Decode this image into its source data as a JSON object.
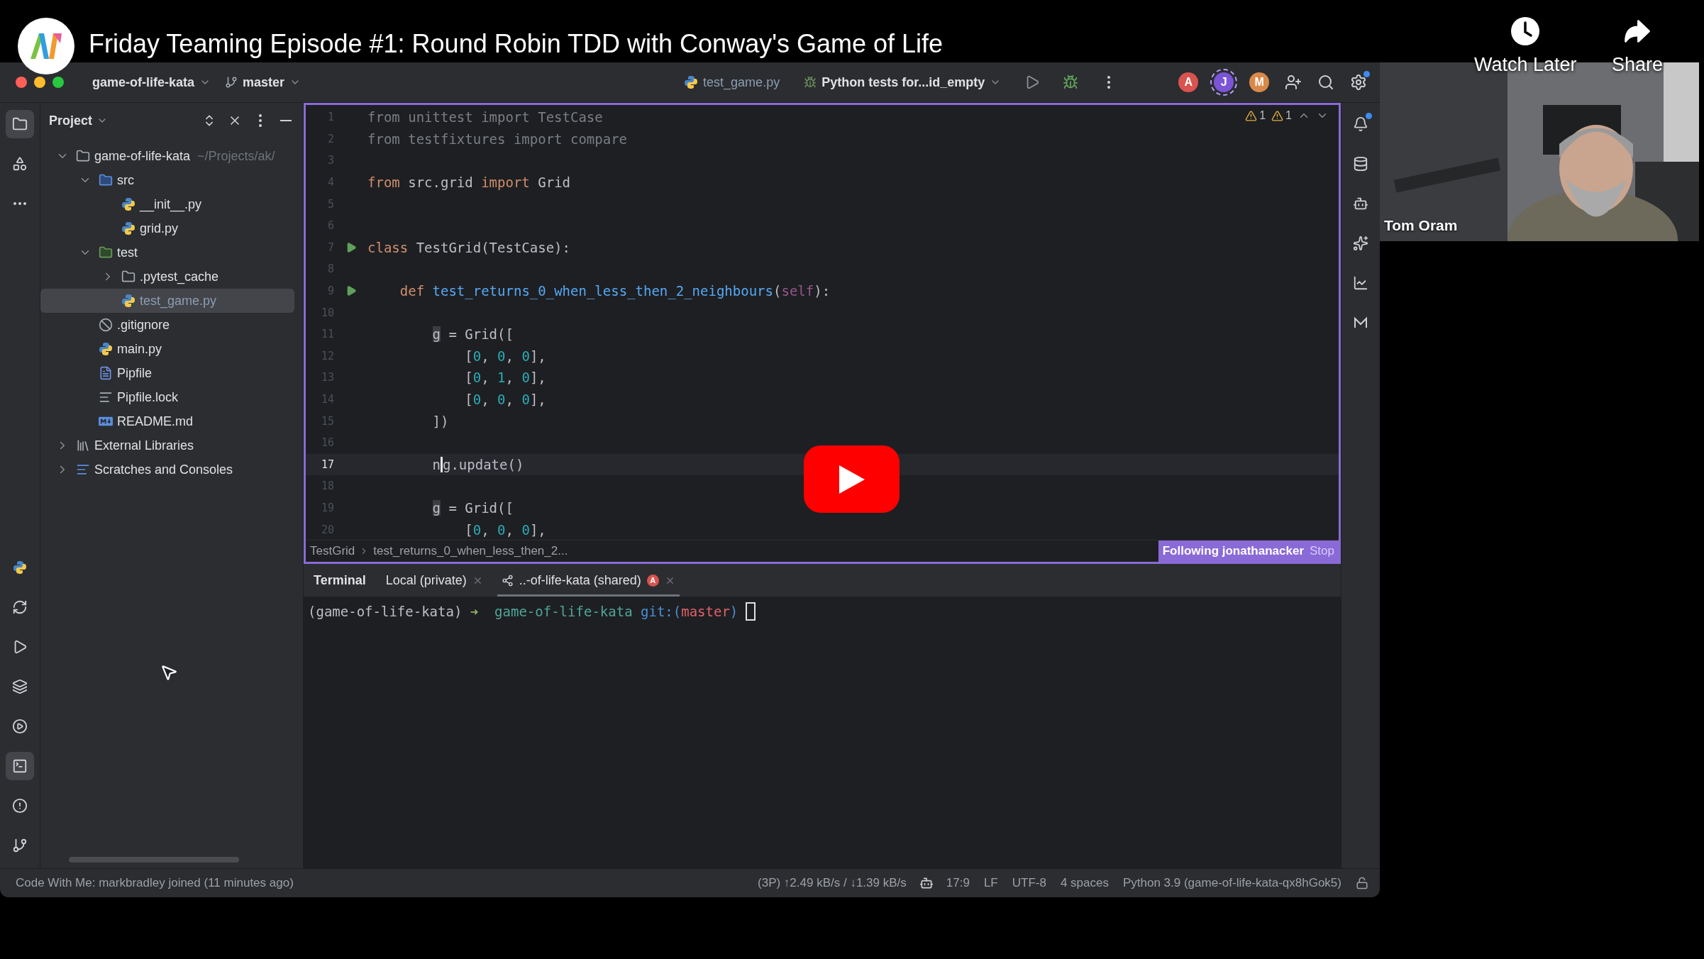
{
  "video": {
    "title": "Friday Teaming Episode #1: Round Robin TDD with Conway's Game of Life",
    "actions": [
      {
        "kind": "clock",
        "label": "Watch Later"
      },
      {
        "kind": "share",
        "label": "Share"
      }
    ],
    "webcam": {
      "kind": "picture",
      "name": "Tom Oram"
    }
  },
  "ide": {
    "toolbar": {
      "project": "game-of-life-kata",
      "branch": "master",
      "file": "test_game.py",
      "run_config": "Python tests for...id_empty",
      "collaborators": [
        {
          "initial": "A",
          "color": "#d9534f",
          "selected": false
        },
        {
          "initial": "J",
          "color": "#7b55d6",
          "selected": true
        },
        {
          "initial": "M",
          "color": "#d98a4a",
          "selected": false
        }
      ],
      "settings_dot": true
    },
    "left_stripe": {
      "top": [
        {
          "kind": "folder",
          "selected": true
        },
        {
          "kind": "structure",
          "selected": false
        },
        {
          "kind": "more",
          "selected": false
        }
      ],
      "bottom": [
        {
          "kind": "python",
          "selected": false
        },
        {
          "kind": "python-console",
          "selected": false
        },
        {
          "kind": "run",
          "selected": false
        },
        {
          "kind": "layers",
          "selected": false
        },
        {
          "kind": "services",
          "selected": false
        },
        {
          "kind": "terminal",
          "selected": true
        },
        {
          "kind": "problems",
          "selected": false
        },
        {
          "kind": "git",
          "selected": false
        }
      ]
    },
    "project": {
      "title": "Project",
      "tree": [
        {
          "label": "game-of-life-kata",
          "hint": "~/Projects/ak/",
          "kind": "folder",
          "expanded": true,
          "selected": false,
          "children": [
            {
              "label": "src",
              "kind": "source-folder",
              "expanded": true,
              "selected": false,
              "children": [
                {
                  "label": "__init__.py",
                  "kind": "python",
                  "selected": false
                },
                {
                  "label": "grid.py",
                  "kind": "python",
                  "selected": false
                }
              ]
            },
            {
              "label": "test",
              "kind": "test-folder",
              "expanded": true,
              "selected": false,
              "children": [
                {
                  "label": ".pytest_cache",
                  "kind": "folder",
                  "expanded": false,
                  "selected": false
                },
                {
                  "label": "test_game.py",
                  "kind": "python",
                  "selected": true
                }
              ]
            },
            {
              "label": ".gitignore",
              "kind": "ignore",
              "selected": false
            },
            {
              "label": "main.py",
              "kind": "python",
              "selected": false
            },
            {
              "label": "Pipfile",
              "kind": "pipfile",
              "selected": false
            },
            {
              "label": "Pipfile.lock",
              "kind": "lines",
              "selected": false
            },
            {
              "label": "README.md",
              "kind": "markdown",
              "selected": false
            }
          ]
        },
        {
          "label": "External Libraries",
          "kind": "libraries",
          "expanded": false,
          "selected": false
        },
        {
          "label": "Scratches and Consoles",
          "kind": "scratches",
          "expanded": false,
          "selected": false
        }
      ]
    },
    "editor": {
      "warnings": [
        {
          "count": "1"
        },
        {
          "count": "1"
        }
      ],
      "lines": [
        {
          "number": "1",
          "run": false,
          "current": false,
          "tokens": [
            {
              "text": "from unittest import TestCase",
              "kind": "unused"
            }
          ]
        },
        {
          "number": "2",
          "run": false,
          "current": false,
          "tokens": [
            {
              "text": "from testfixtures import compare",
              "kind": "unused"
            }
          ]
        },
        {
          "number": "3",
          "run": false,
          "current": false
        },
        {
          "number": "4",
          "run": false,
          "current": false,
          "tokens": [
            {
              "text": "from",
              "kind": "keyword"
            },
            {
              "text": " src.grid ",
              "kind": "plain"
            },
            {
              "text": "import",
              "kind": "keyword"
            },
            {
              "text": " Grid",
              "kind": "plain"
            }
          ]
        },
        {
          "number": "5",
          "run": false,
          "current": false
        },
        {
          "number": "6",
          "run": false,
          "current": false
        },
        {
          "number": "7",
          "run": true,
          "current": false,
          "tokens": [
            {
              "text": "class",
              "kind": "keyword"
            },
            {
              "text": " TestGrid(TestCase):",
              "kind": "plain"
            }
          ]
        },
        {
          "number": "8",
          "run": false,
          "current": false
        },
        {
          "number": "9",
          "run": true,
          "current": false,
          "tokens": [
            {
              "text": "    def",
              "kind": "keyword"
            },
            {
              "text": " test_returns_0_when_less_then_2_neighbours",
              "kind": "function"
            },
            {
              "text": "(",
              "kind": "plain"
            },
            {
              "text": "self",
              "kind": "self"
            },
            {
              "text": "):",
              "kind": "plain"
            }
          ]
        },
        {
          "number": "10",
          "run": false,
          "current": false
        },
        {
          "number": "11",
          "run": false,
          "current": false,
          "tokens": [
            {
              "text": "        g",
              "kind": "highlight"
            },
            {
              "text": " = Grid([",
              "kind": "plain"
            }
          ]
        },
        {
          "number": "12",
          "run": false,
          "current": false,
          "tokens": [
            {
              "text": "            [",
              "kind": "plain"
            },
            {
              "text": "0",
              "kind": "number"
            },
            {
              "text": ", ",
              "kind": "plain"
            },
            {
              "text": "0",
              "kind": "number"
            },
            {
              "text": ", ",
              "kind": "plain"
            },
            {
              "text": "0",
              "kind": "number"
            },
            {
              "text": "],",
              "kind": "plain"
            }
          ]
        },
        {
          "number": "13",
          "run": false,
          "current": false,
          "tokens": [
            {
              "text": "            [",
              "kind": "plain"
            },
            {
              "text": "0",
              "kind": "number"
            },
            {
              "text": ", ",
              "kind": "plain"
            },
            {
              "text": "1",
              "kind": "number"
            },
            {
              "text": ", ",
              "kind": "plain"
            },
            {
              "text": "0",
              "kind": "number"
            },
            {
              "text": "],",
              "kind": "plain"
            }
          ]
        },
        {
          "number": "14",
          "run": false,
          "current": false,
          "tokens": [
            {
              "text": "            [",
              "kind": "plain"
            },
            {
              "text": "0",
              "kind": "number"
            },
            {
              "text": ", ",
              "kind": "plain"
            },
            {
              "text": "0",
              "kind": "number"
            },
            {
              "text": ", ",
              "kind": "plain"
            },
            {
              "text": "0",
              "kind": "number"
            },
            {
              "text": "],",
              "kind": "plain"
            }
          ]
        },
        {
          "number": "15",
          "run": false,
          "current": false,
          "tokens": [
            {
              "text": "        ])",
              "kind": "plain"
            }
          ]
        },
        {
          "number": "16",
          "run": false,
          "current": false
        },
        {
          "number": "17",
          "run": false,
          "current": true,
          "tokens": [
            {
              "text": "        n",
              "kind": "plain"
            },
            {
              "text": "g",
              "kind": "caret"
            },
            {
              "text": ".update()",
              "kind": "plain"
            }
          ]
        },
        {
          "number": "18",
          "run": false,
          "current": false
        },
        {
          "number": "19",
          "run": false,
          "current": false,
          "tokens": [
            {
              "text": "        g",
              "kind": "highlight"
            },
            {
              "text": " = Grid([",
              "kind": "plain"
            }
          ]
        },
        {
          "number": "20",
          "run": false,
          "current": false,
          "tokens": [
            {
              "text": "            [",
              "kind": "plain"
            },
            {
              "text": "0",
              "kind": "number"
            },
            {
              "text": ", ",
              "kind": "plain"
            },
            {
              "text": "0",
              "kind": "number"
            },
            {
              "text": ", ",
              "kind": "plain"
            },
            {
              "text": "0",
              "kind": "number"
            },
            {
              "text": "],",
              "kind": "plain"
            }
          ]
        }
      ],
      "breadcrumbs": [
        "TestGrid",
        "test_returns_0_when_less_then_2..."
      ],
      "following": {
        "label": "Following jonathanacker",
        "action": "Stop"
      }
    },
    "terminal": {
      "title": "Terminal",
      "tabs": [
        {
          "label": "Local (private)",
          "shared": false,
          "selected": false
        },
        {
          "label": "..-of-life-kata (shared)",
          "shared": true,
          "selected": true,
          "avatar": {
            "initial": "A",
            "color": "#d9534f"
          }
        }
      ],
      "prompt": [
        {
          "text": "(game-of-life-kata) ",
          "kind": "plain"
        },
        {
          "text": "➜",
          "kind": "arrow"
        },
        {
          "text": "  game-of-life-kata",
          "kind": "dir"
        },
        {
          "text": " git:(",
          "kind": "git"
        },
        {
          "text": "master",
          "kind": "branch"
        },
        {
          "text": ")",
          "kind": "git"
        },
        {
          "kind": "cursor"
        }
      ]
    },
    "right_stripe": [
      {
        "kind": "bell",
        "dot": true
      },
      {
        "kind": "database",
        "dot": false
      },
      {
        "kind": "robot",
        "dot": false
      },
      {
        "kind": "ai",
        "dot": false
      },
      {
        "kind": "chart",
        "dot": false
      },
      {
        "kind": "zigzag",
        "dot": false
      }
    ],
    "status_bar": {
      "message": "Code With Me: markbradley joined (11 minutes ago)",
      "items": [
        {
          "kind": "text",
          "text": "(3P) ↑2.49 kB/s / ↓1.39 kB/s"
        },
        {
          "kind": "robot"
        },
        {
          "kind": "text",
          "text": "17:9"
        },
        {
          "kind": "text",
          "text": "LF"
        },
        {
          "kind": "text",
          "text": "UTF-8"
        },
        {
          "kind": "text",
          "text": "4 spaces"
        },
        {
          "kind": "text",
          "text": "Python 3.9 (game-of-life-kata-qx8hGok5)"
        },
        {
          "kind": "lock"
        }
      ]
    }
  }
}
